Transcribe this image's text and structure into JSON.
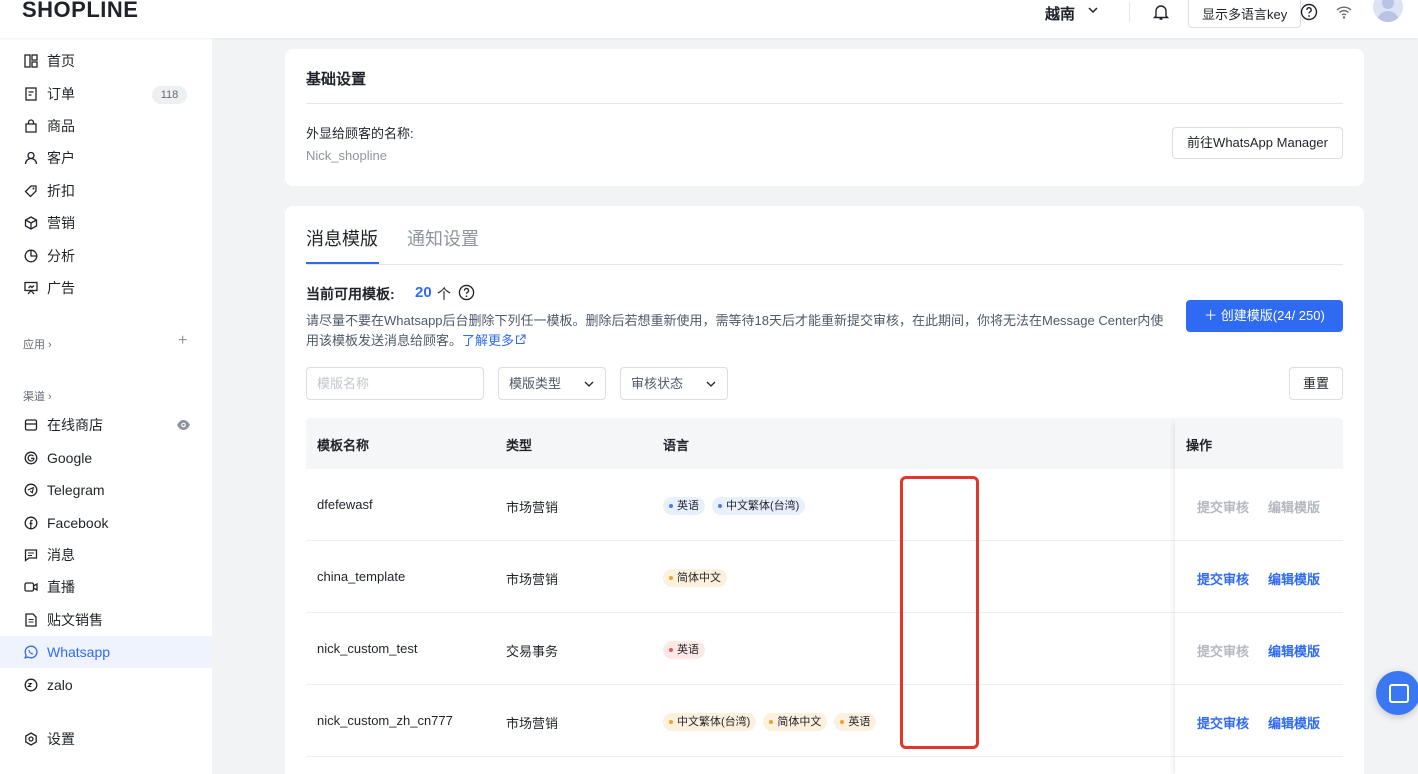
{
  "app": {
    "logo": "SHOPLINE",
    "language": "越南",
    "show_key_button": "显示多语言key"
  },
  "sidebar": {
    "items": [
      {
        "label": "首页",
        "icon": "home-icon"
      },
      {
        "label": "订单",
        "icon": "order-icon",
        "badge": "118"
      },
      {
        "label": "商品",
        "icon": "product-icon"
      },
      {
        "label": "客户",
        "icon": "customer-icon"
      },
      {
        "label": "折扣",
        "icon": "discount-icon"
      },
      {
        "label": "营销",
        "icon": "marketing-icon"
      },
      {
        "label": "分析",
        "icon": "analytics-icon"
      },
      {
        "label": "广告",
        "icon": "ads-icon"
      }
    ],
    "apps_label": "应用 ›",
    "channels_label": "渠道 ›",
    "channels": [
      {
        "label": "在线商店",
        "icon": "store-icon"
      },
      {
        "label": "Google",
        "icon": "google-icon"
      },
      {
        "label": "Telegram",
        "icon": "telegram-icon"
      },
      {
        "label": "Facebook",
        "icon": "facebook-icon"
      },
      {
        "label": "消息",
        "icon": "message-icon"
      },
      {
        "label": "直播",
        "icon": "live-icon"
      },
      {
        "label": "贴文销售",
        "icon": "post-icon"
      },
      {
        "label": "Whatsapp",
        "icon": "whatsapp-icon",
        "active": true
      },
      {
        "label": "zalo",
        "icon": "zalo-icon"
      }
    ],
    "settings": "设置"
  },
  "basic": {
    "title": "基础设置",
    "name_label": "外显给顾客的名称:",
    "name_value": "Nick_shopline",
    "manager_button": "前往WhatsApp Manager"
  },
  "templates": {
    "tabs": [
      "消息模版",
      "通知设置"
    ],
    "available_label": "当前可用模板:",
    "available_count": "20",
    "available_unit": "个",
    "notice": "请尽量不要在Whatsapp后台删除下列任一模板。删除后若想重新使用，需等待18天后才能重新提交审核，在此期间，你将无法在Message Center内使用该模板发送消息给顾客。",
    "learn_more": "了解更多",
    "create_button": "＋  创建模版(24/ 250)",
    "filter_name_placeholder": "模版名称",
    "filter_type": "模版类型",
    "filter_status": "审核状态",
    "reset_button": "重置",
    "columns": [
      "模板名称",
      "类型",
      "语言",
      "操作"
    ],
    "rows": [
      {
        "name": "dfefewasf",
        "type": "市场营销",
        "langs": [
          "英语",
          "中文繁体(台湾)"
        ],
        "lang_style": "blue",
        "submit": "提交审核",
        "submit_enabled": false,
        "edit": "编辑模版",
        "edit_enabled": false
      },
      {
        "name": "china_template",
        "type": "市场营销",
        "langs": [
          "简体中文"
        ],
        "lang_style": "orange",
        "submit": "提交审核",
        "submit_enabled": true,
        "edit": "编辑模版",
        "edit_enabled": true
      },
      {
        "name": "nick_custom_test",
        "type": "交易事务",
        "langs": [
          "英语"
        ],
        "lang_style": "red",
        "submit": "提交审核",
        "submit_enabled": false,
        "edit": "编辑模版",
        "edit_enabled": true
      },
      {
        "name": "nick_custom_zh_cn777",
        "type": "市场营销",
        "langs": [
          "中文繁体(台湾)",
          "简体中文",
          "英语"
        ],
        "lang_style": "orange",
        "submit": "提交审核",
        "submit_enabled": true,
        "edit": "编辑模版",
        "edit_enabled": true
      }
    ]
  },
  "colors": {
    "accent": "#2f6bf2",
    "highlight_border": "#e0362c",
    "disabled_text": "#b4b8bf"
  }
}
